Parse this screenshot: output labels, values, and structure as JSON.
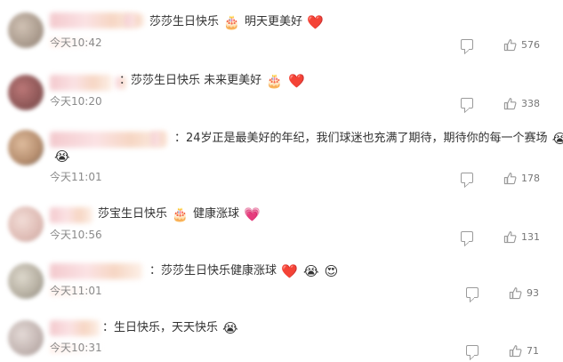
{
  "comments": [
    {
      "text": "莎莎生日快乐",
      "text2": "明天更美好",
      "emojis": [
        "🎂",
        "❤️"
      ],
      "time": "今天10:42",
      "likes": "576"
    },
    {
      "prefix": "：",
      "text": "莎莎生日快乐 未来更美好",
      "emojis": [
        "🎂",
        "❤️"
      ],
      "time": "今天10:20",
      "likes": "338"
    },
    {
      "prefix": "：",
      "text": "24岁正是最美好的年纪，我们球迷也充满了期待，期待你的每一个赛场",
      "emojis": [
        "😭",
        "😭"
      ],
      "time": "今天11:01",
      "likes": "178"
    },
    {
      "text": "莎宝生日快乐",
      "text2": "健康涨球",
      "emojis": [
        "🎂",
        "💗"
      ],
      "time": "今天10:56",
      "likes": "131"
    },
    {
      "prefix": "：",
      "text": "莎莎生日快乐健康涨球",
      "emojis": [
        "❤️",
        "😭",
        "😍"
      ],
      "time": "今天11:01",
      "likes": "93"
    },
    {
      "prefix": "：",
      "text": "生日快乐，天天快乐",
      "emojis": [
        "😭"
      ],
      "time": "今天10:31",
      "likes": "71"
    }
  ],
  "icons": {
    "reply": "comment-icon",
    "like": "thumbs-up-icon"
  }
}
